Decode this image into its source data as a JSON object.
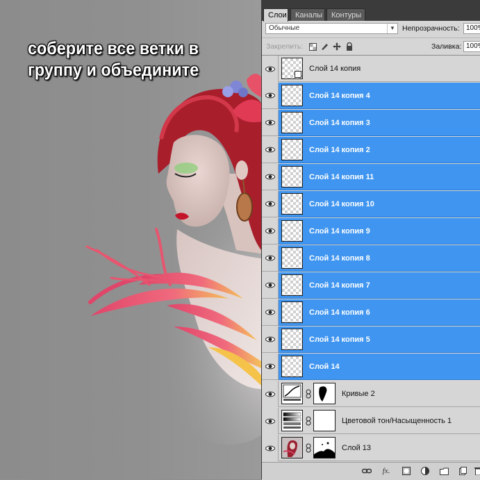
{
  "canvas": {
    "instruction": "соберите все ветки в группу и объедините"
  },
  "panel": {
    "tabs": [
      {
        "label": "Слои",
        "active": true
      },
      {
        "label": "Каналы",
        "active": false
      },
      {
        "label": "Контуры",
        "active": false
      }
    ],
    "blend_mode": "Обычные",
    "opacity_label": "Непрозрачность:",
    "opacity_value": "100%",
    "lock_label": "Закрепить:",
    "fill_label": "Заливка:",
    "fill_value": "100%",
    "selection_color": "#3f95f0",
    "layers": [
      {
        "name": "Слой 14 копия",
        "selected": false,
        "visible": true,
        "type": "smart-object"
      },
      {
        "name": "Слой 14 копия 4",
        "selected": true,
        "visible": true,
        "type": "pixel"
      },
      {
        "name": "Слой 14 копия 3",
        "selected": true,
        "visible": true,
        "type": "pixel"
      },
      {
        "name": "Слой 14 копия 2",
        "selected": true,
        "visible": true,
        "type": "pixel"
      },
      {
        "name": "Слой 14 копия 11",
        "selected": true,
        "visible": true,
        "type": "pixel"
      },
      {
        "name": "Слой 14 копия 10",
        "selected": true,
        "visible": true,
        "type": "pixel"
      },
      {
        "name": "Слой 14 копия 9",
        "selected": true,
        "visible": true,
        "type": "pixel"
      },
      {
        "name": "Слой 14 копия 8",
        "selected": true,
        "visible": true,
        "type": "pixel"
      },
      {
        "name": "Слой 14 копия 7",
        "selected": true,
        "visible": true,
        "type": "pixel"
      },
      {
        "name": "Слой 14 копия 6",
        "selected": true,
        "visible": true,
        "type": "pixel"
      },
      {
        "name": "Слой 14 копия 5",
        "selected": true,
        "visible": true,
        "type": "pixel"
      },
      {
        "name": "Слой 14",
        "selected": true,
        "visible": true,
        "type": "pixel"
      },
      {
        "name": "Кривые 2",
        "selected": false,
        "visible": true,
        "type": "curves-adjustment"
      },
      {
        "name": "Цветовой тон/Насыщенность 1",
        "selected": false,
        "visible": true,
        "type": "hue-saturation-adjustment"
      },
      {
        "name": "Слой 13",
        "selected": false,
        "visible": true,
        "type": "photo-with-mask"
      }
    ],
    "footer_icons": [
      "link-layers-icon",
      "fx-icon",
      "add-mask-icon",
      "adjustment-layer-icon",
      "new-group-icon",
      "new-layer-icon",
      "delete-layer-icon"
    ]
  }
}
